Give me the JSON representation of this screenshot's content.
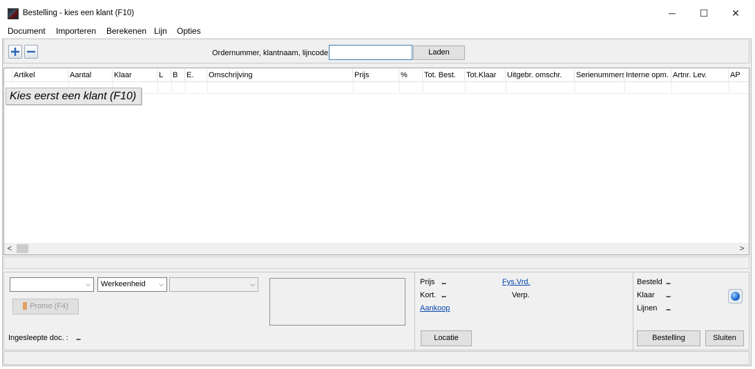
{
  "window": {
    "title": "Bestelling - kies een klant (F10)",
    "controls": [
      "─",
      "☐",
      "✕"
    ]
  },
  "menu": [
    "Document",
    "Importeren",
    "Berekenen",
    "Lijn",
    "Opties"
  ],
  "toolbar": {
    "add_icon": "plus-icon",
    "remove_icon": "minus-icon",
    "order_label": "Ordernummer, klantnaam, lijncode",
    "order_value": "",
    "load_button": "Laden"
  },
  "grid": {
    "columns": [
      "Artikel",
      "Aantal",
      "Klaar",
      "L",
      "B",
      "E.",
      "Omschrijving",
      "Prijs",
      "%",
      "Tot. Best.",
      "Tot.Klaar",
      "Uitgebr. omschr.",
      "Serienummers",
      "Interne opm.",
      "Artnr. Lev.",
      "AP"
    ],
    "choose_customer_button": "Kies eerst een klant (F10)"
  },
  "scrollbar": {
    "left_arrow": "<",
    "right_arrow": ">"
  },
  "bottom_left": {
    "combo1_value": "",
    "combo2_value": "Werkeenheid",
    "combo3_value": "",
    "promo_button": "Promo (F4)",
    "dragged_docs_label": "Ingesleepte doc. :",
    "dragged_docs_value": "..."
  },
  "bottom_mid": {
    "price_label": "Prijs",
    "price_value": "...",
    "discount_label": "Kort.",
    "discount_value": "...",
    "purchase_link": "Aankoop",
    "fys_link": "Fys.Vrd.",
    "pack_label": "Verp.",
    "location_button": "Locatie"
  },
  "bottom_right": {
    "ordered_label": "Besteld",
    "ordered_value": "...",
    "ready_label": "Klaar",
    "ready_value": "...",
    "lines_label": "Lijnen",
    "lines_value": "...",
    "order_button": "Bestelling",
    "close_button": "Sluiten",
    "refresh_icon": "globe-refresh-icon"
  }
}
